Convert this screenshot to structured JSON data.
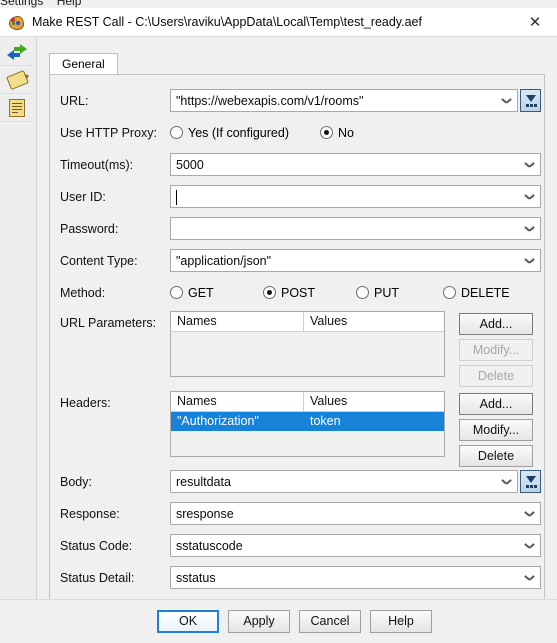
{
  "background_menu": {
    "items": [
      "Settings",
      "Help"
    ]
  },
  "window": {
    "title": "Make REST Call - C:\\Users\\raviku\\AppData\\Local\\Temp\\test_ready.aef",
    "app_icon": "palette-icon",
    "close_label": "✕"
  },
  "sidebar": {
    "items": [
      {
        "icon": "arrows-icon",
        "name": "navigate"
      },
      {
        "icon": "tag-pencil-icon",
        "name": "annotate"
      },
      {
        "icon": "document-icon",
        "name": "document"
      }
    ]
  },
  "tabs": [
    {
      "label": "General",
      "active": true
    }
  ],
  "form": {
    "url": {
      "label": "URL:",
      "value": "\"https://webexapis.com/v1/rooms\"",
      "has_expression_button": true
    },
    "proxy": {
      "label": "Use HTTP Proxy:",
      "options": [
        {
          "label": "Yes (If configured)",
          "selected": false
        },
        {
          "label": "No",
          "selected": true
        }
      ]
    },
    "timeout": {
      "label": "Timeout(ms):",
      "value": "5000"
    },
    "user_id": {
      "label": "User ID:",
      "value": "",
      "focused": true
    },
    "password": {
      "label": "Password:",
      "value": ""
    },
    "content_type": {
      "label": "Content Type:",
      "value": "\"application/json\""
    },
    "method": {
      "label": "Method:",
      "options": [
        {
          "label": "GET",
          "selected": false
        },
        {
          "label": "POST",
          "selected": true
        },
        {
          "label": "PUT",
          "selected": false
        },
        {
          "label": "DELETE",
          "selected": false
        }
      ]
    },
    "url_parameters": {
      "label": "URL Parameters:",
      "columns": [
        "Names",
        "Values"
      ],
      "rows": [],
      "buttons": [
        {
          "label": "Add...",
          "enabled": true
        },
        {
          "label": "Modify...",
          "enabled": false
        },
        {
          "label": "Delete",
          "enabled": false
        }
      ]
    },
    "headers": {
      "label": "Headers:",
      "columns": [
        "Names",
        "Values"
      ],
      "rows": [
        {
          "name": "\"Authorization\"",
          "value": "token",
          "selected": true
        }
      ],
      "buttons": [
        {
          "label": "Add...",
          "enabled": true
        },
        {
          "label": "Modify...",
          "enabled": true
        },
        {
          "label": "Delete",
          "enabled": true
        }
      ]
    },
    "body": {
      "label": "Body:",
      "value": "resultdata",
      "has_expression_button": true
    },
    "response": {
      "label": "Response:",
      "value": "sresponse"
    },
    "status_code": {
      "label": "Status Code:",
      "value": "sstatuscode"
    },
    "status_detail": {
      "label": "Status Detail:",
      "value": "sstatus"
    }
  },
  "footer": {
    "buttons": [
      {
        "label": "OK",
        "focused": true
      },
      {
        "label": "Apply",
        "focused": false
      },
      {
        "label": "Cancel",
        "focused": false
      },
      {
        "label": "Help",
        "focused": false
      }
    ]
  },
  "colors": {
    "selection_blue": "#1683d8",
    "focus_blue": "#1e80d8",
    "dialog_bg": "#f0f0f0"
  }
}
